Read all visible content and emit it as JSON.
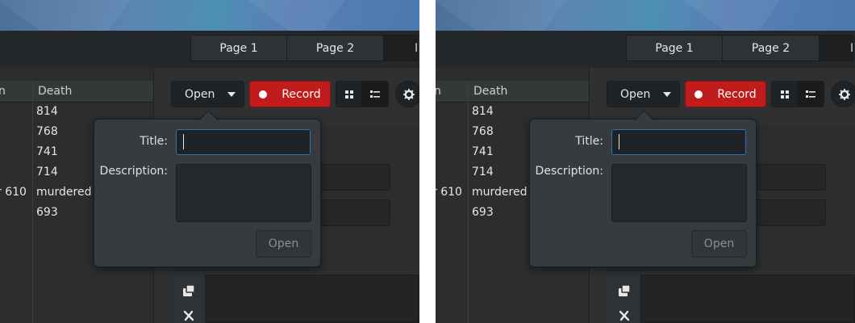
{
  "panels": [
    {
      "id": "left",
      "tabs": [
        "Page 1",
        "Page 2",
        "P"
      ],
      "table": {
        "header_left": "n",
        "header_death": "Death",
        "rows": [
          {
            "left": "",
            "death": "814"
          },
          {
            "left": "",
            "death": "768"
          },
          {
            "left": "",
            "death": "741"
          },
          {
            "left": "",
            "death": "714"
          },
          {
            "left": "r 610",
            "death": "murdered I"
          },
          {
            "left": "",
            "death": "693"
          }
        ]
      },
      "toolbar": {
        "open_label": "Open",
        "record_label": "Record"
      },
      "popover": {
        "title_label": "Title:",
        "description_label": "Description:",
        "title_value": "",
        "open_button_label": "Open"
      }
    },
    {
      "id": "right",
      "tabs": [
        "Page 1",
        "Page 2",
        "P"
      ],
      "table": {
        "header_left": "n",
        "header_death": "Death",
        "rows": [
          {
            "left": "",
            "death": "814"
          },
          {
            "left": "",
            "death": "768"
          },
          {
            "left": "",
            "death": "741"
          },
          {
            "left": "",
            "death": "714"
          },
          {
            "left": "r 610",
            "death": "murdered I"
          },
          {
            "left": "",
            "death": "693"
          }
        ]
      },
      "toolbar": {
        "open_label": "Open",
        "record_label": "Record"
      },
      "popover": {
        "title_label": "Title:",
        "description_label": "Description:",
        "title_value": "",
        "open_button_label": "Open"
      }
    }
  ],
  "colors": {
    "record": "#c11c1c",
    "focus": "#2e6fb5",
    "background": "#2e3032"
  }
}
